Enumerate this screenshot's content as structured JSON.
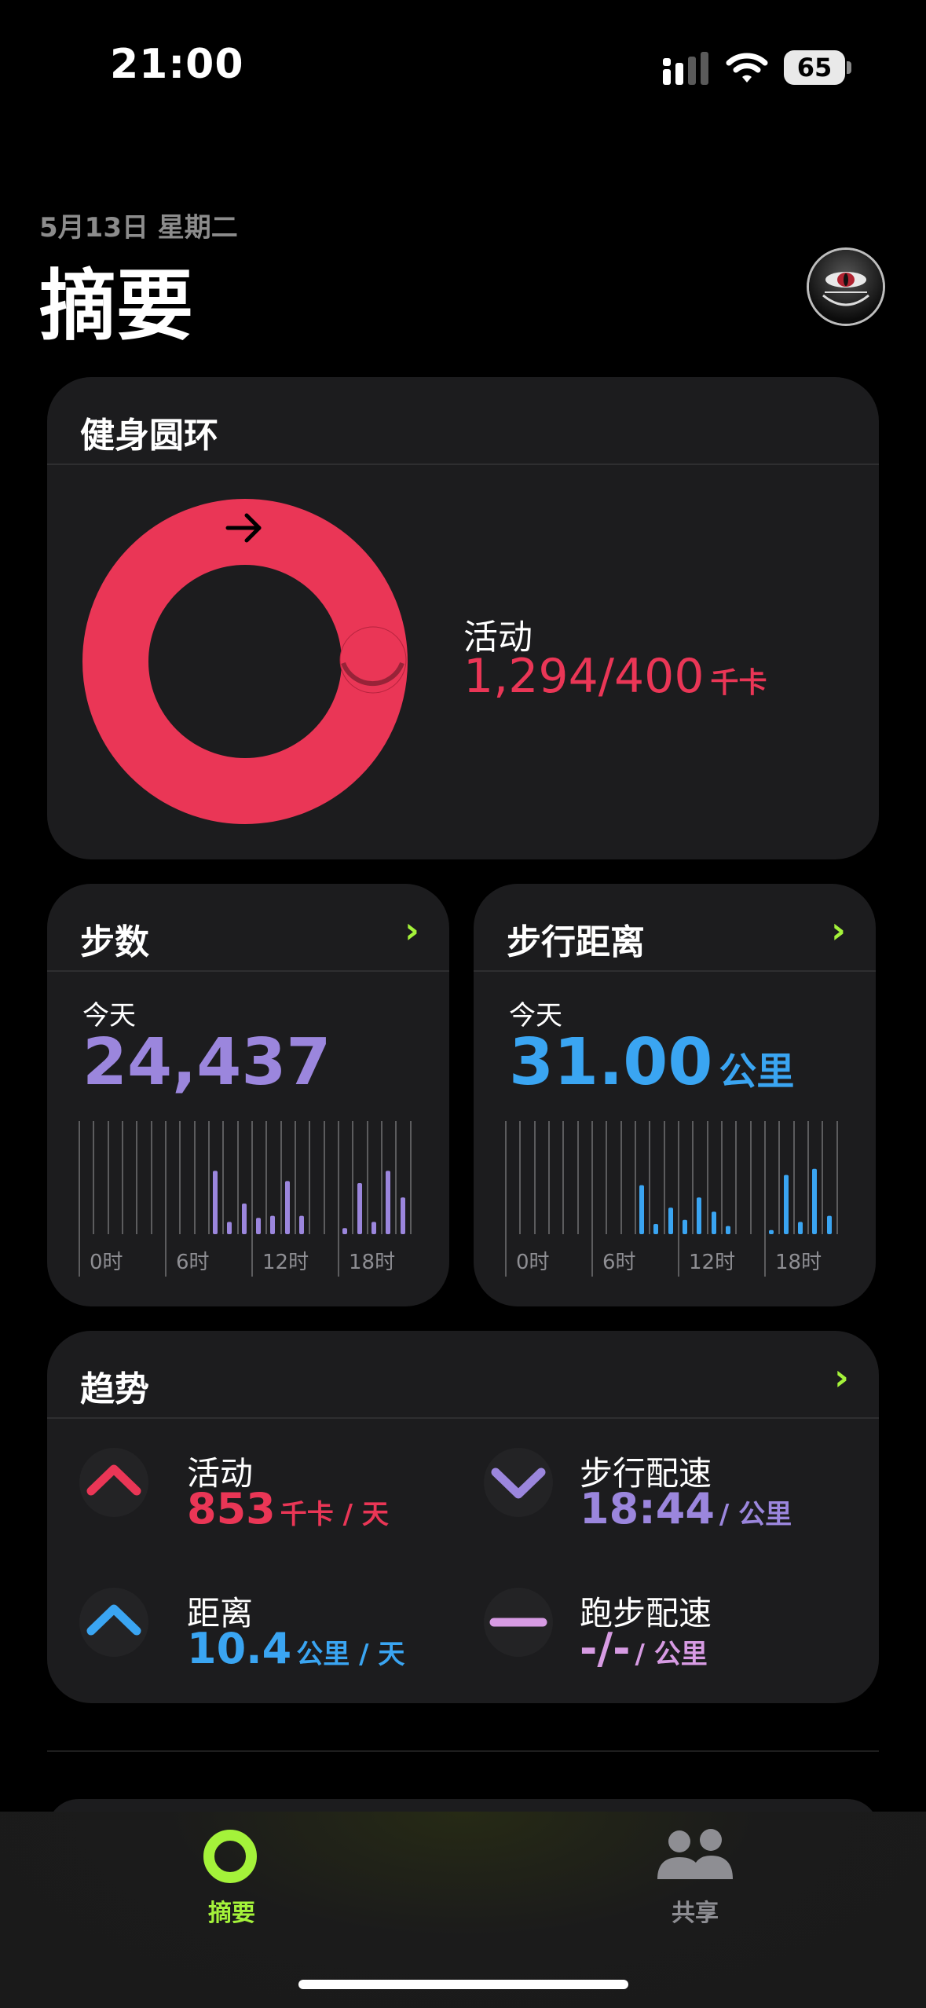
{
  "status": {
    "time": "21:00",
    "battery": "65"
  },
  "header": {
    "date": "5月13日 星期二",
    "title": "摘要"
  },
  "rings": {
    "title": "健身圆环",
    "label": "活动",
    "value": "1,294/400",
    "unit": "千卡",
    "progress": 3.235,
    "color": "#ea3656"
  },
  "steps": {
    "title": "步数",
    "today_label": "今天",
    "value": "24,437",
    "color": "#9b86dd",
    "axis": [
      "0时",
      "6时",
      "12时",
      "18时"
    ],
    "bars": [
      0,
      0,
      0,
      0,
      0,
      0,
      0,
      0,
      0,
      0.62,
      0.12,
      0.3,
      0.16,
      0.18,
      0.52,
      0.18,
      0,
      0,
      0.06,
      0.5,
      0.12,
      0.62,
      0.36,
      0
    ]
  },
  "distance": {
    "title": "步行距离",
    "today_label": "今天",
    "value": "31.00",
    "unit": "公里",
    "color": "#3aa5f2",
    "axis": [
      "0时",
      "6时",
      "12时",
      "18时"
    ],
    "bars": [
      0,
      0,
      0,
      0,
      0,
      0,
      0,
      0,
      0,
      0.48,
      0.1,
      0.26,
      0.14,
      0.36,
      0.22,
      0.08,
      0,
      0,
      0.04,
      0.58,
      0.12,
      0.64,
      0.18,
      0
    ]
  },
  "trends": {
    "title": "趋势",
    "items": [
      {
        "label": "活动",
        "value": "853",
        "unit": "千卡 / 天",
        "color": "#ea3656",
        "icon": "chevron-up-icon"
      },
      {
        "label": "步行配速",
        "value": "18:44",
        "unit": "/ 公里",
        "color": "#9b86dd",
        "icon": "chevron-down-icon"
      },
      {
        "label": "距离",
        "value": "10.4",
        "unit": "公里 / 天",
        "color": "#3aa5f2",
        "icon": "chevron-up-icon"
      },
      {
        "label": "跑步配速",
        "value": "-/-",
        "unit": "/ 公里",
        "color": "#d79be3",
        "icon": "dash-icon"
      }
    ]
  },
  "tabs": [
    {
      "label": "摘要",
      "active": true,
      "color": "#a4f23a",
      "icon": "summary-ring-icon"
    },
    {
      "label": "共享",
      "active": false,
      "color": "#8e8e93",
      "icon": "people-icon"
    }
  ]
}
